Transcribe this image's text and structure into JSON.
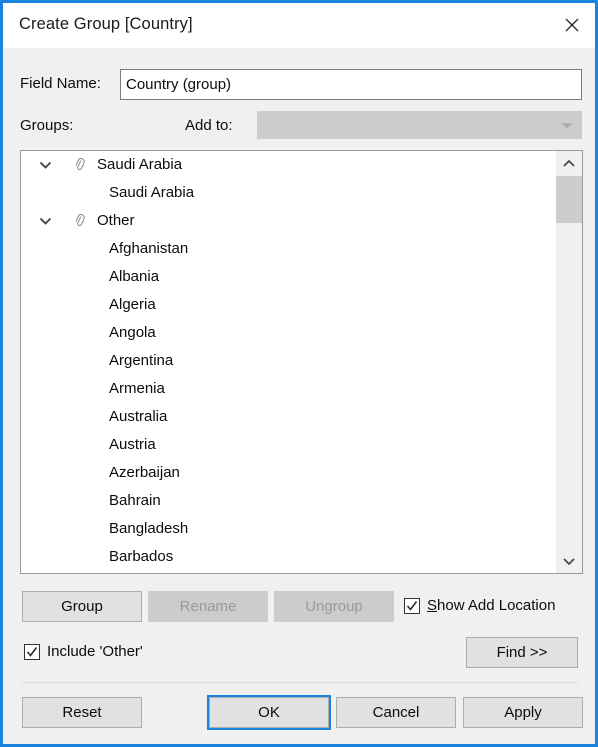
{
  "window": {
    "title": "Create Group [Country]",
    "close_icon": "close-icon",
    "accent_color": "#1a84dc",
    "body_color": "#f0f0f0"
  },
  "form": {
    "field_name_label": "Field Name:",
    "field_name_value": "Country (group)",
    "field_name_placeholder": "",
    "groups_label": "Groups:",
    "add_to_label": "Add to:",
    "add_to_value": "",
    "add_to_placeholder": "",
    "add_to_arrow_icon": "chevron-down-icon"
  },
  "list": {
    "group_icon": "paperclip-icon",
    "expander_icon": "chevron-down-icon",
    "rows": [
      {
        "label": "Saudi Arabia",
        "type": "group",
        "expanded": true
      },
      {
        "label": "Saudi Arabia",
        "type": "member",
        "expanded": false
      },
      {
        "label": "Other",
        "type": "group",
        "expanded": true
      },
      {
        "label": "Afghanistan",
        "type": "member",
        "expanded": false
      },
      {
        "label": "Albania",
        "type": "member",
        "expanded": false
      },
      {
        "label": "Algeria",
        "type": "member",
        "expanded": false
      },
      {
        "label": "Angola",
        "type": "member",
        "expanded": false
      },
      {
        "label": "Argentina",
        "type": "member",
        "expanded": false
      },
      {
        "label": "Armenia",
        "type": "member",
        "expanded": false
      },
      {
        "label": "Australia",
        "type": "member",
        "expanded": false
      },
      {
        "label": "Austria",
        "type": "member",
        "expanded": false
      },
      {
        "label": "Azerbaijan",
        "type": "member",
        "expanded": false
      },
      {
        "label": "Bahrain",
        "type": "member",
        "expanded": false
      },
      {
        "label": "Bangladesh",
        "type": "member",
        "expanded": false
      },
      {
        "label": "Barbados",
        "type": "member",
        "expanded": false
      }
    ],
    "scrollbar": {
      "up_icon": "chevron-up-icon",
      "down_icon": "chevron-down-icon"
    }
  },
  "actions": {
    "group_label": "Group",
    "rename_label": "Rename",
    "ungroup_label": "Ungroup",
    "find_label": "Find >>",
    "show_add_location_label": "Show Add Location",
    "show_add_location_accel": "S",
    "show_add_location_rest": "how Add Location",
    "show_add_location_checked": true,
    "include_other_label": "Include 'Other'",
    "include_other_checked": true
  },
  "footer": {
    "reset_label": "Reset",
    "ok_label": "OK",
    "cancel_label": "Cancel",
    "apply_label": "Apply"
  }
}
